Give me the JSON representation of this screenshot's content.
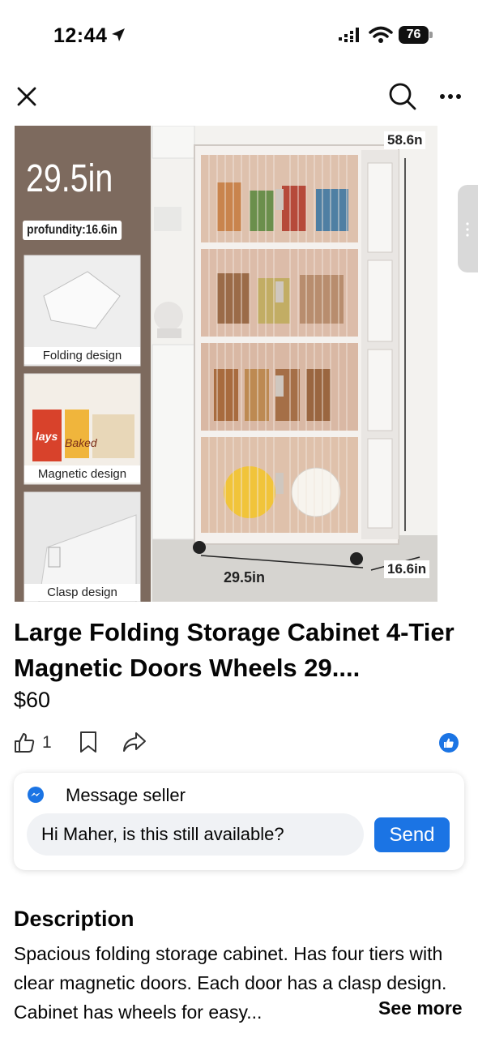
{
  "status_bar": {
    "time": "12:44",
    "battery": "76",
    "icons": [
      "location-arrow-icon",
      "cellular-signal-icon",
      "wifi-icon",
      "battery-icon"
    ]
  },
  "nav": {
    "icons": [
      "close-icon",
      "search-icon",
      "more-icon"
    ]
  },
  "product_image": {
    "height_label": "29.5in",
    "depth_label": "profundity:16.6in",
    "features": [
      {
        "label": "Folding design"
      },
      {
        "label": "Magnetic design"
      },
      {
        "label": "Clasp design"
      }
    ],
    "dim_height": "58.6n",
    "dim_width": "29.5in",
    "dim_depth": "16.6in",
    "brand_text_1": "lays",
    "brand_text_2": "Baked"
  },
  "listing": {
    "title": "Large  Folding Storage Cabinet 4-Tier Magnetic Doors Wheels 29....",
    "price": "$60",
    "like_count": "1"
  },
  "actions": {
    "icons": [
      "like-icon",
      "save-icon",
      "share-icon",
      "like-reaction-icon"
    ]
  },
  "message_seller": {
    "title": "Message seller",
    "input_value": "Hi Maher, is this still available?",
    "send_label": "Send"
  },
  "description": {
    "heading": "Description",
    "body": "Spacious folding storage cabinet. Has four tiers with clear magnetic doors. Each door has a clasp design. Cabinet has wheels for easy...",
    "see_more": "See more"
  },
  "colors": {
    "accent": "#1b74e4",
    "text": "#050505",
    "input_bg": "#f0f2f5",
    "image_panel": "#7d6a5e"
  }
}
